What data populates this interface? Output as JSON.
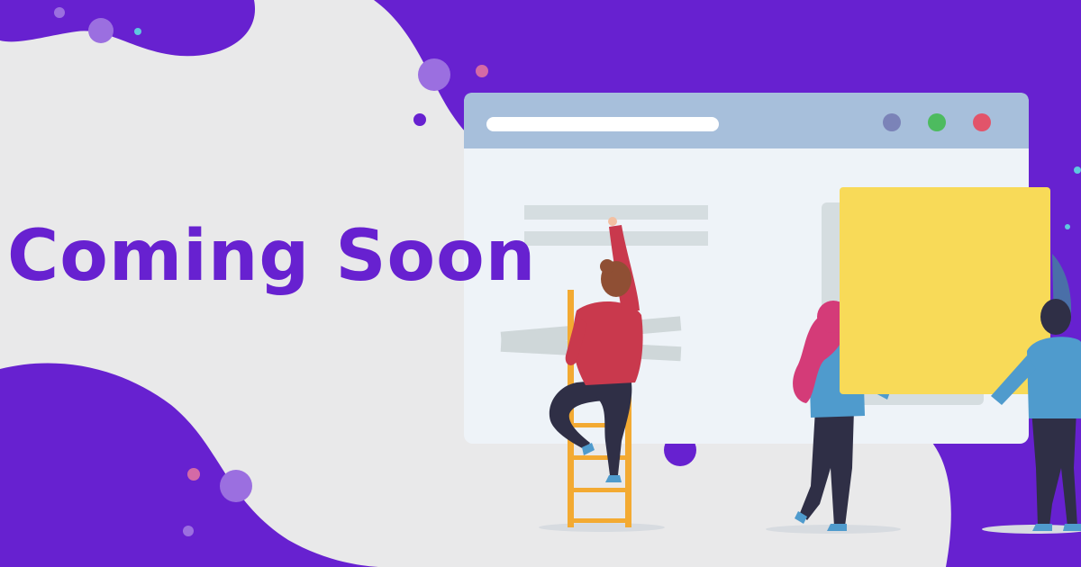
{
  "headline": "Coming Soon",
  "colors": {
    "brand_purple": "#6721d0",
    "background": "#e9e9ea",
    "browser_bar": "#a7bfdb",
    "browser_body": "#eef3f8",
    "dot_blue": "#7b83b8",
    "dot_green": "#4dbb5f",
    "dot_red": "#e2546a",
    "sticky_note": "#f8da58",
    "ladder": "#f3aa32",
    "shirt_red": "#c9394d",
    "shirt_blue": "#4f9bcd",
    "hair_pink": "#d43b78",
    "pants": "#2f2f46"
  },
  "icons": {
    "browser_controls": [
      "minimize-dot-icon",
      "maximize-dot-icon",
      "close-dot-icon"
    ]
  }
}
